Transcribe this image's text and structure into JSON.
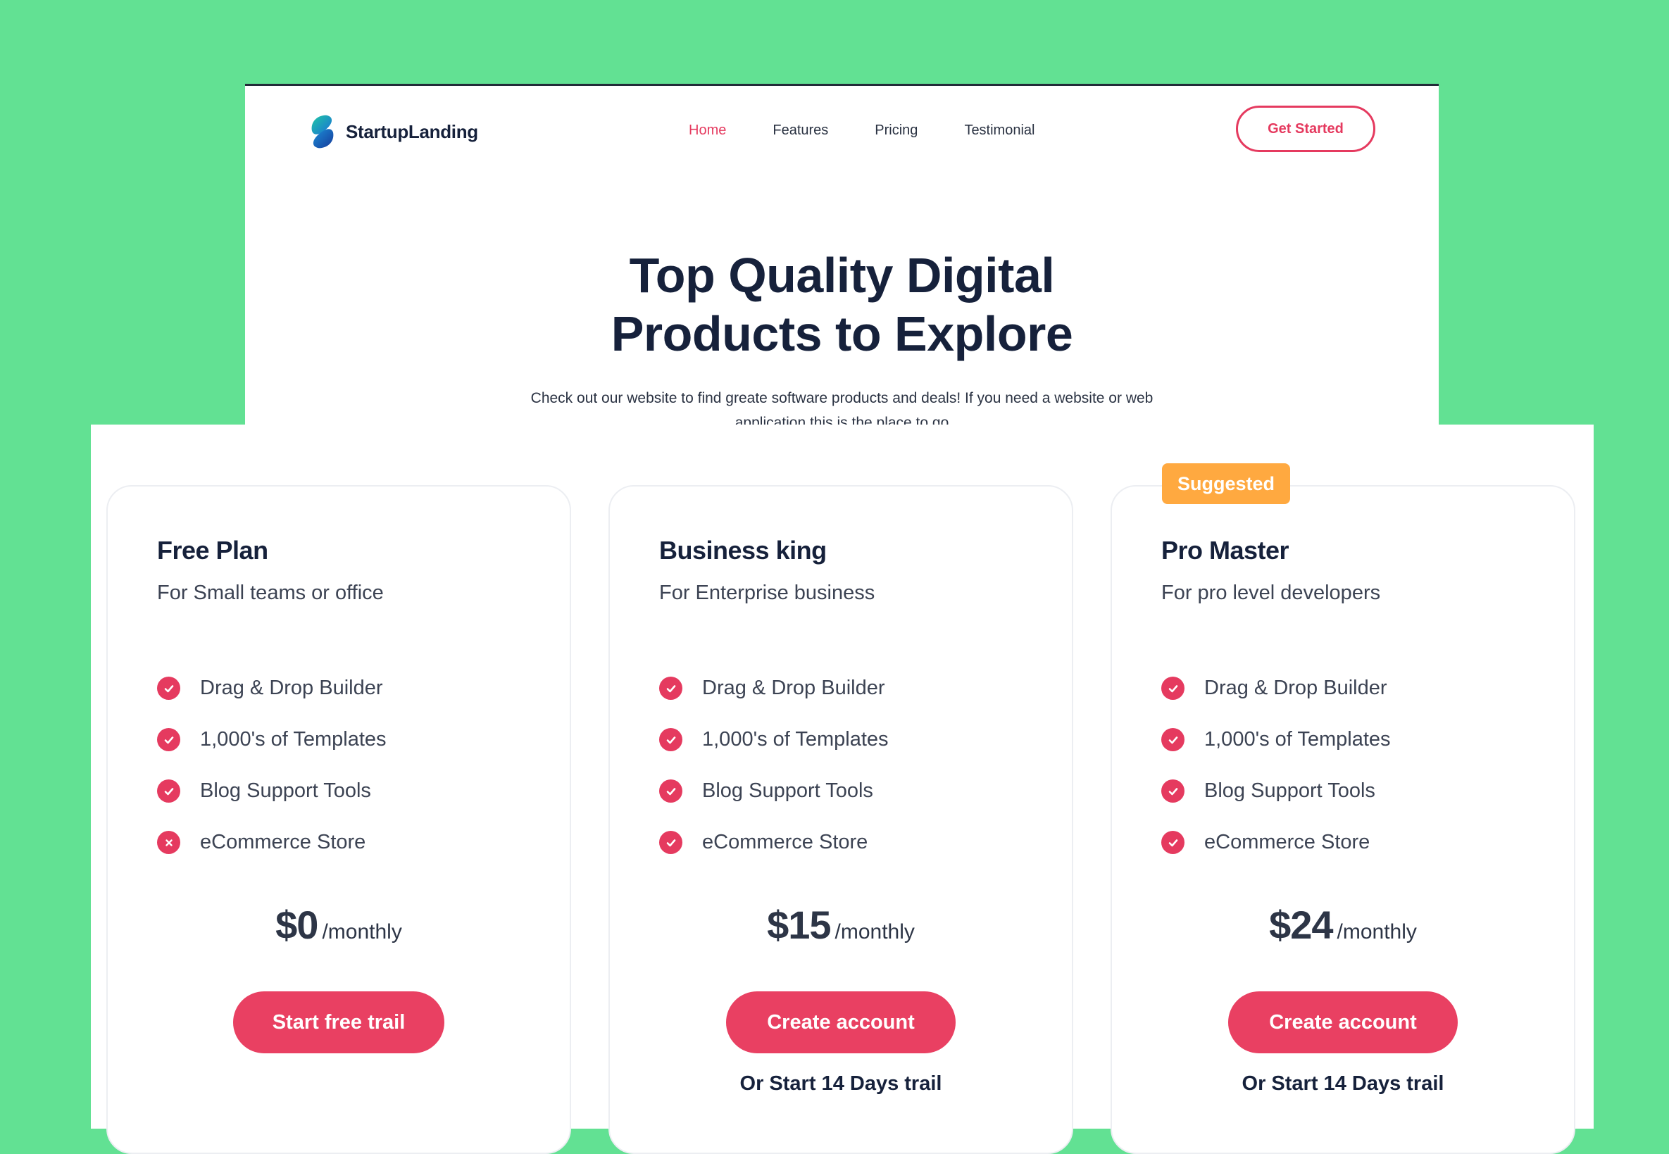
{
  "site": {
    "brand": "StartupLanding",
    "nav": [
      {
        "label": "Home",
        "active": true
      },
      {
        "label": "Features",
        "active": false
      },
      {
        "label": "Pricing",
        "active": false
      },
      {
        "label": "Testimonial",
        "active": false
      }
    ],
    "cta_label": "Get Started",
    "hero_title_line1": "Top Quality Digital",
    "hero_title_line2": "Products to Explore",
    "hero_subtitle": "Check out our website to find greate software products and deals! If you need a website or web application this is the place to go"
  },
  "pricing": {
    "badge": "Suggested",
    "plans": [
      {
        "name": "Free Plan",
        "description": "For Small teams or office",
        "features": [
          {
            "label": "Drag & Drop Builder",
            "included": true
          },
          {
            "label": "1,000's of Templates",
            "included": true
          },
          {
            "label": "Blog Support Tools",
            "included": true
          },
          {
            "label": "eCommerce Store",
            "included": false
          }
        ],
        "price": "$0",
        "period": "/monthly",
        "button_label": "Start free trail",
        "trial_text": ""
      },
      {
        "name": "Business king",
        "description": "For Enterprise business",
        "features": [
          {
            "label": "Drag & Drop Builder",
            "included": true
          },
          {
            "label": "1,000's of Templates",
            "included": true
          },
          {
            "label": "Blog Support Tools",
            "included": true
          },
          {
            "label": "eCommerce Store",
            "included": true
          }
        ],
        "price": "$15",
        "period": "/monthly",
        "button_label": "Create account",
        "trial_text": "Or Start 14 Days trail"
      },
      {
        "name": "Pro Master",
        "description": "For pro level developers",
        "features": [
          {
            "label": "Drag & Drop Builder",
            "included": true
          },
          {
            "label": "1,000's of Templates",
            "included": true
          },
          {
            "label": "Blog Support Tools",
            "included": true
          },
          {
            "label": "eCommerce Store",
            "included": true
          }
        ],
        "price": "$24",
        "period": "/monthly",
        "button_label": "Create account",
        "trial_text": "Or Start 14 Days trail"
      }
    ]
  },
  "colors": {
    "background": "#62e193",
    "accent": "#e53a5f",
    "badge": "#ffa940",
    "heading": "#16213b"
  }
}
